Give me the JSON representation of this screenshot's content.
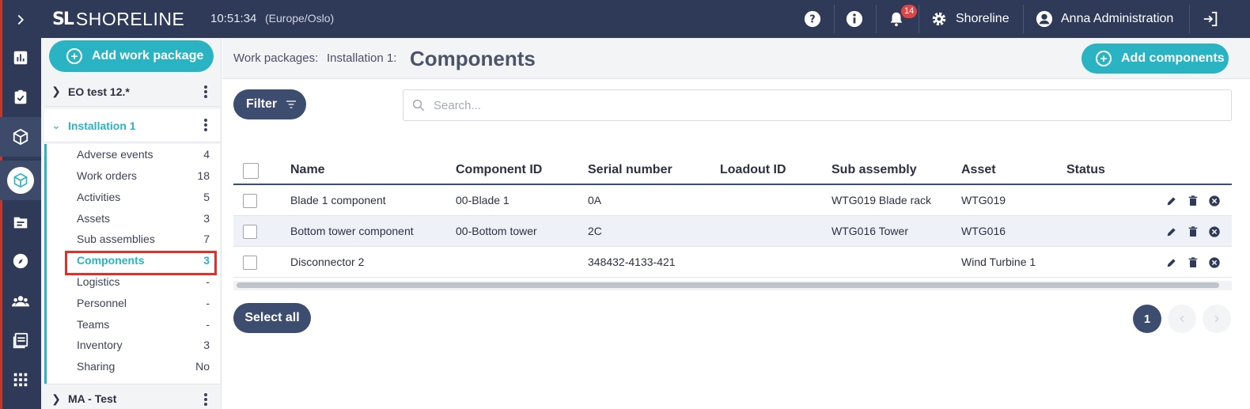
{
  "topbar": {
    "logo_mark": "SL",
    "logo_text": "SHORELINE",
    "time": "10:51:34",
    "timezone": "(Europe/Oslo)",
    "notification_count": "14",
    "org_name": "Shoreline",
    "user_name": "Anna Administration",
    "icons": [
      "help-icon",
      "info-icon",
      "bell-icon",
      "gear-icon",
      "user-icon",
      "logout-icon"
    ]
  },
  "rail": {
    "icons": [
      "chevron-right-icon",
      "dashboard-icon",
      "clipboard-check-icon",
      "cube-icon",
      "work-package-icon",
      "folder-icon",
      "compass-icon",
      "people-icon",
      "calendar-icon",
      "apps-grid-icon"
    ]
  },
  "sidebar": {
    "add_label": "Add work package",
    "packages": [
      {
        "title": "EO test 12.*"
      },
      {
        "title": "Installation 1"
      },
      {
        "title": "MA - Test"
      }
    ],
    "items": [
      {
        "label": "Adverse events",
        "count": "4"
      },
      {
        "label": "Work orders",
        "count": "18"
      },
      {
        "label": "Activities",
        "count": "5"
      },
      {
        "label": "Assets",
        "count": "3"
      },
      {
        "label": "Sub assemblies",
        "count": "7"
      },
      {
        "label": "Components",
        "count": "3"
      },
      {
        "label": "Logistics",
        "count": "-"
      },
      {
        "label": "Personnel",
        "count": "-"
      },
      {
        "label": "Teams",
        "count": "-"
      },
      {
        "label": "Inventory",
        "count": "3"
      },
      {
        "label": "Sharing",
        "count": "No"
      }
    ]
  },
  "main": {
    "breadcrumb_1": "Work packages:",
    "breadcrumb_2": "Installation 1:",
    "title": "Components",
    "add_label": "Add components",
    "filter_label": "Filter",
    "search_placeholder": "Search...",
    "columns": [
      "Name",
      "Component ID",
      "Serial number",
      "Loadout ID",
      "Sub assembly",
      "Asset",
      "Status"
    ],
    "rows": [
      {
        "name": "Blade 1 component",
        "component_id": "00-Blade 1",
        "serial": "0A",
        "loadout": "",
        "sub_assembly": "WTG019 Blade rack",
        "asset": "WTG019",
        "status": ""
      },
      {
        "name": "Bottom tower component",
        "component_id": "00-Bottom tower",
        "serial": "2C",
        "loadout": "",
        "sub_assembly": "WTG016 Tower",
        "asset": "WTG016",
        "status": ""
      },
      {
        "name": "Disconnector 2",
        "component_id": "",
        "serial": "348432-4133-421",
        "loadout": "",
        "sub_assembly": "",
        "asset": "Wind Turbine 1",
        "status": ""
      }
    ],
    "select_all_label": "Select all",
    "current_page": "1"
  },
  "colors": {
    "navy": "#2e3a57",
    "accent": "#2ab3c2",
    "button_dark": "#3d4d70",
    "highlight": "#e0302a"
  }
}
